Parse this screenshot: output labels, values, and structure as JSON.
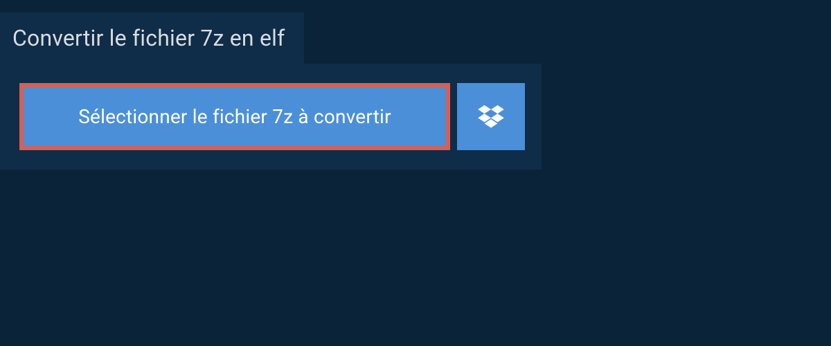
{
  "header": {
    "title": "Convertir le fichier 7z en elf"
  },
  "upload": {
    "select_label": "Sélectionner le fichier 7z à convertir"
  }
}
